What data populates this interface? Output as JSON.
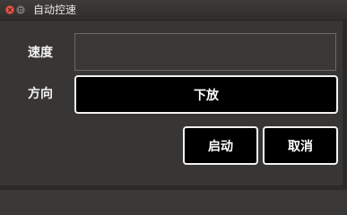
{
  "window": {
    "title": "自动控速"
  },
  "form": {
    "speed_label": "速度",
    "speed_value": "",
    "direction_label": "方向",
    "direction_value": "下放"
  },
  "actions": {
    "start_label": "启动",
    "cancel_label": "取消"
  },
  "colors": {
    "background": "#383634",
    "button_bg": "#000000",
    "button_border": "#f2f2f2",
    "close_button": "#e35b4d"
  },
  "icons": {
    "close": "close-icon",
    "minimize": "minimize-icon"
  }
}
